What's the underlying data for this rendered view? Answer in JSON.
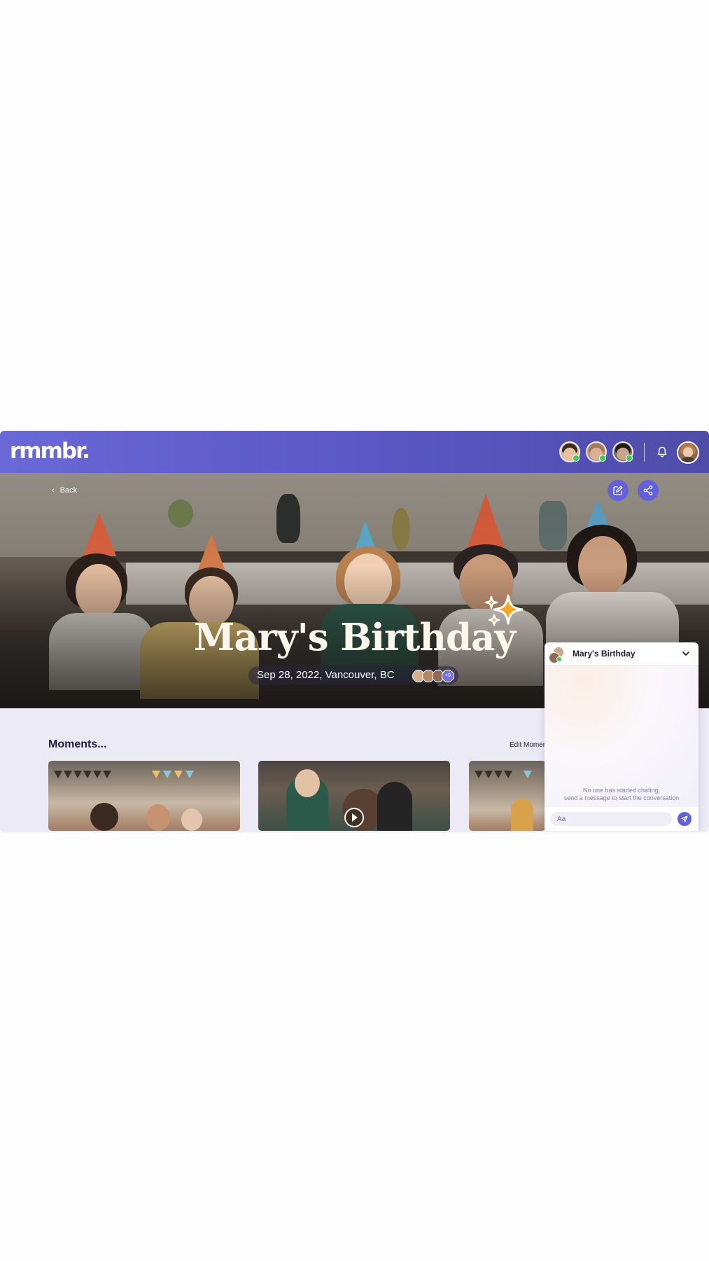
{
  "app": {
    "logo": "rmmbr."
  },
  "header": {
    "collaborators": [
      {
        "name": "collaborator-1",
        "status": "online"
      },
      {
        "name": "collaborator-2",
        "status": "online"
      },
      {
        "name": "collaborator-3",
        "status": "online"
      }
    ],
    "icons": {
      "notifications": "bell-icon",
      "profile": "user-avatar"
    }
  },
  "hero": {
    "back_label": "Back",
    "title": "Mary's Birthday",
    "date": "Sep 28, 2022,",
    "location": "Vancouver, BC",
    "attendees_extra": "+9",
    "actions": {
      "edit": "edit-icon",
      "share": "share-icon"
    }
  },
  "moments": {
    "title": "Moments...",
    "edit_label": "Edit Moments",
    "items": [
      {
        "type": "photo"
      },
      {
        "type": "video"
      },
      {
        "type": "photo"
      }
    ]
  },
  "chat": {
    "title": "Mary's Birthday",
    "empty_line1": "No one has started chating,",
    "empty_line2": "send a message to start the conversation",
    "input_placeholder": "Aa"
  },
  "colors": {
    "accent": "#6360db",
    "header_gradient_start": "#6a68d6",
    "header_gradient_end": "#4f4ca8",
    "online": "#3ec95f",
    "sparkle": "#f5a623",
    "title_text": "#fbf7ec",
    "page_bg": "#eceaf5"
  }
}
